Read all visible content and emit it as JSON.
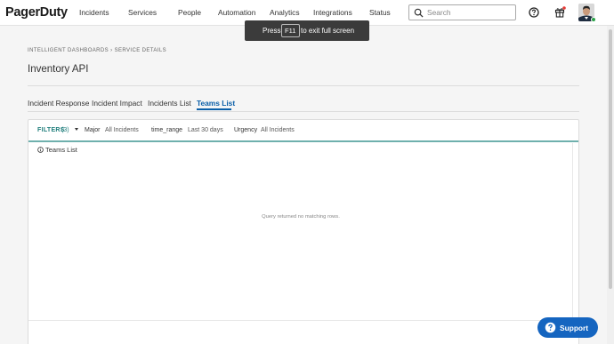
{
  "header": {
    "logo": "PagerDuty",
    "nav": [
      "Incidents",
      "Services",
      "People",
      "Automation",
      "Analytics",
      "Integrations",
      "Status"
    ],
    "search_placeholder": "Search"
  },
  "toast": {
    "before": "Press",
    "key": "F11",
    "after": "to exit full screen"
  },
  "breadcrumb": "INTELLIGENT DASHBOARDS › SERVICE DETAILS",
  "page_title": "Inventory API",
  "tabs": [
    "Incident Response",
    "Incident Impact",
    "Incidents List",
    "Teams List"
  ],
  "active_tab": "Teams List",
  "filters": {
    "label": "FILTERS",
    "count": "(3)",
    "items": [
      {
        "key": "Major",
        "value": "All Incidents"
      },
      {
        "key": "time_range",
        "value": "Last 30 days"
      },
      {
        "key": "Urgency",
        "value": "All Incidents"
      }
    ]
  },
  "tile": {
    "title": "Teams List",
    "empty_message": "Query returned no matching rows."
  },
  "support_label": "Support",
  "colors": {
    "accent": "#0b5fa8",
    "filter_teal": "#1e7d7b",
    "support_blue": "#1565c0",
    "online_green": "#2aa148"
  }
}
